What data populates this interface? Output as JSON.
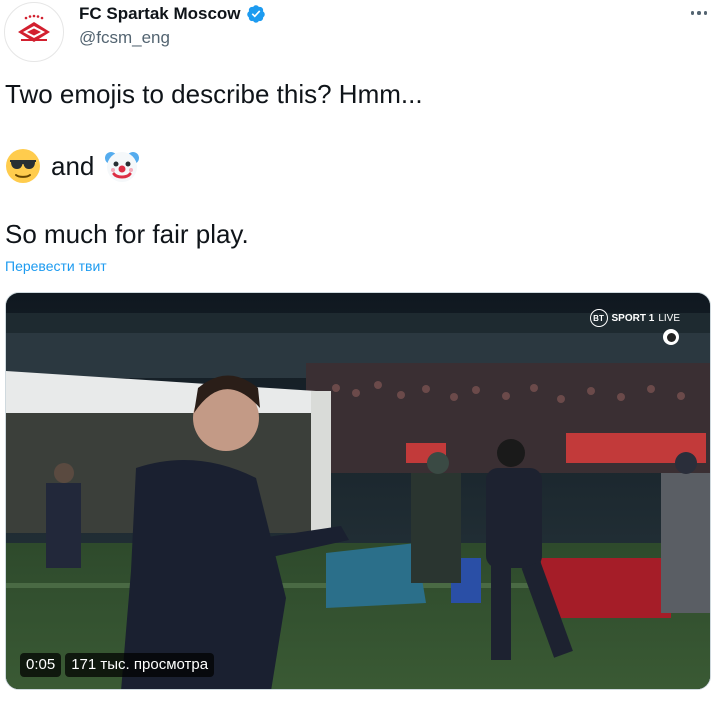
{
  "tweet": {
    "display_name": "FC Spartak Moscow",
    "handle": "@fcsm_eng",
    "verified": true,
    "text_line_1": "Two emojis to describe this? Hmm...",
    "text_and": "and",
    "text_line_3": "So much for fair play.",
    "emojis": [
      "sunglasses-emoji",
      "clown-emoji"
    ],
    "translate_label": "Перевести твит"
  },
  "media": {
    "broadcaster": "SPORT 1",
    "broadcaster_badge": "BT",
    "live_label": "LIVE",
    "duration": "0:05",
    "views": "171 тыс. просмотра"
  },
  "colors": {
    "accent": "#1d9bf0",
    "text": "#0f1419",
    "secondary": "#536471",
    "spartak_red": "#d2202f"
  }
}
